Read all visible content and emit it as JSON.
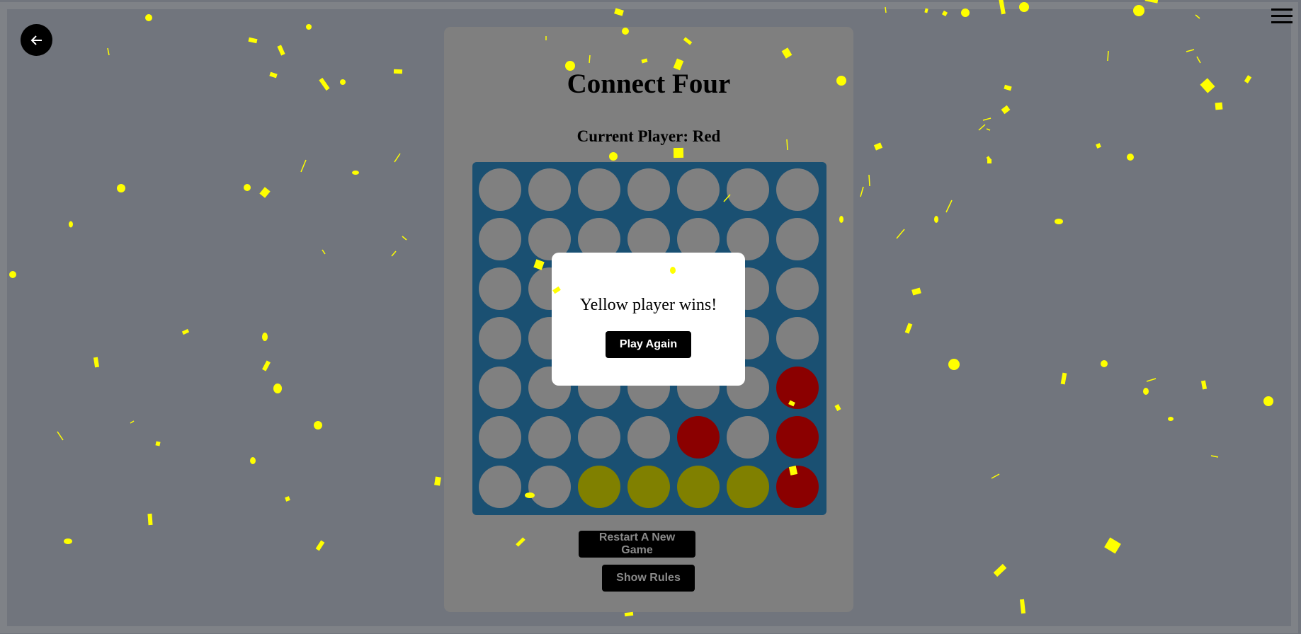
{
  "game": {
    "title": "Connect Four",
    "current_player_text": "Current Player: Red",
    "board": [
      [
        "empty",
        "empty",
        "empty",
        "empty",
        "empty",
        "empty",
        "empty"
      ],
      [
        "empty",
        "empty",
        "empty",
        "empty",
        "empty",
        "empty",
        "empty"
      ],
      [
        "empty",
        "empty",
        "empty",
        "empty",
        "empty",
        "empty",
        "empty"
      ],
      [
        "empty",
        "empty",
        "empty",
        "empty",
        "empty",
        "empty",
        "empty"
      ],
      [
        "empty",
        "empty",
        "empty",
        "empty",
        "empty",
        "empty",
        "red"
      ],
      [
        "empty",
        "empty",
        "empty",
        "empty",
        "red",
        "empty",
        "red"
      ],
      [
        "empty",
        "empty",
        "yellow",
        "yellow",
        "yellow",
        "yellow",
        "red"
      ]
    ],
    "colors": {
      "board": "#1a5072",
      "empty": "#808080",
      "red": "#8b0000",
      "yellow": "#808000",
      "confetti": "#ffff00",
      "background": "#71757d"
    }
  },
  "buttons": {
    "restart_label": "Restart A New Game",
    "rules_label": "Show Rules",
    "play_again_label": "Play Again"
  },
  "modal": {
    "message": "Yellow player wins!"
  },
  "icons": {
    "back": "back-arrow-icon",
    "menu": "hamburger-menu-icon"
  }
}
